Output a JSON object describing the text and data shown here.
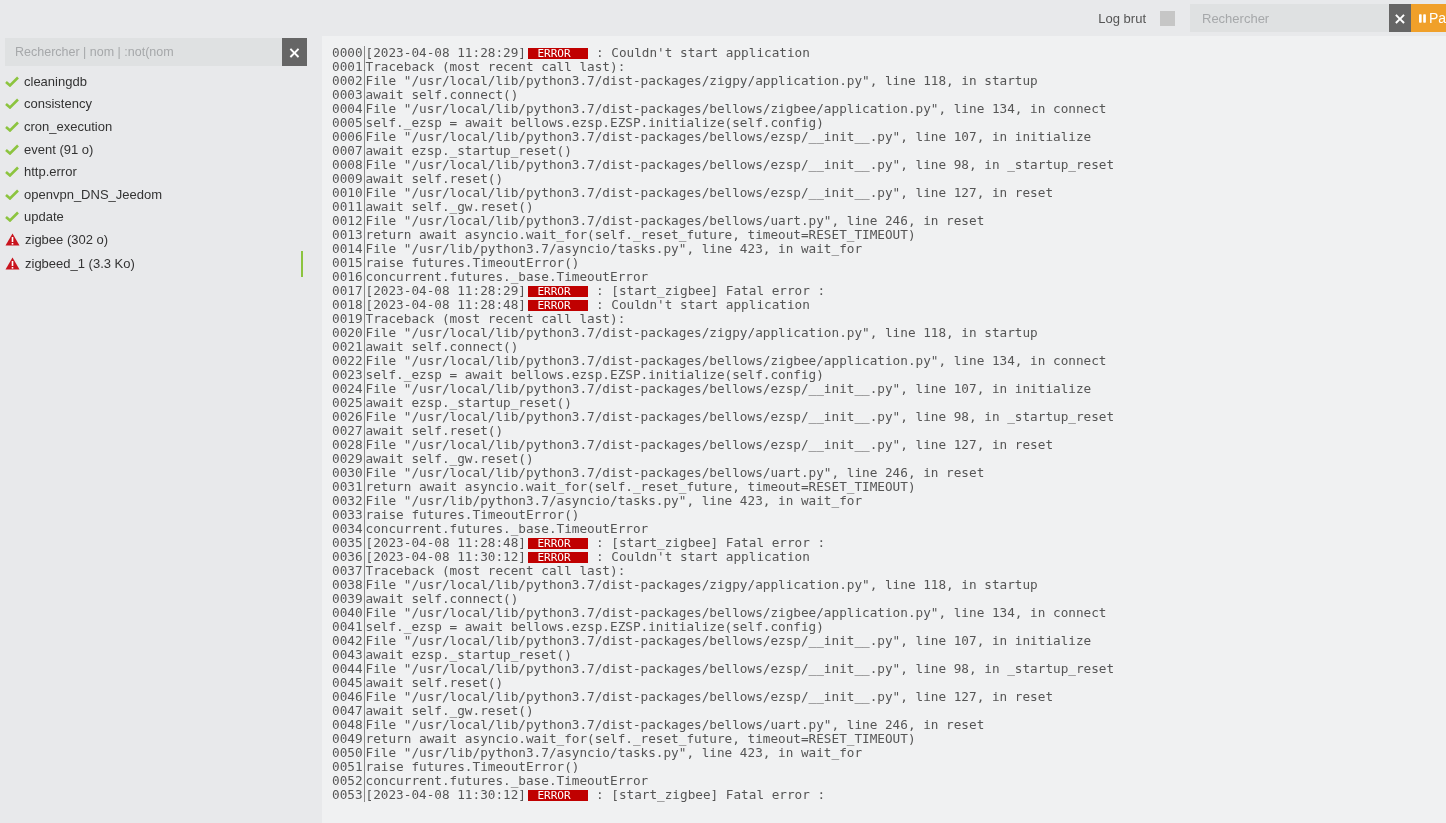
{
  "toolbar": {
    "raw_log_label": "Log brut",
    "raw_log_checked": false,
    "search": {
      "placeholder": "Rechercher"
    },
    "clear_button": "×",
    "pause_button": "Pa"
  },
  "sidebar": {
    "search": {
      "placeholder": "Rechercher | nom | :not(nom"
    },
    "clear_button": "×",
    "items": [
      {
        "label": "cleaningdb",
        "kind": "check",
        "selected": false
      },
      {
        "label": "consistency",
        "kind": "check",
        "selected": false
      },
      {
        "label": "cron_execution",
        "kind": "check",
        "selected": false
      },
      {
        "label": "event (91 o)",
        "kind": "check",
        "selected": false
      },
      {
        "label": "http.error",
        "kind": "check",
        "selected": false
      },
      {
        "label": "openvpn_DNS_Jeedom",
        "kind": "check",
        "selected": false
      },
      {
        "label": "update",
        "kind": "check",
        "selected": false
      },
      {
        "label": "zigbee (302 o)",
        "kind": "warning",
        "selected": false
      },
      {
        "label": "zigbeed_1 (3.3 Ko)",
        "kind": "warning",
        "selected": true
      }
    ]
  },
  "log": [
    {
      "number": "0000",
      "kind": "entry",
      "timestamp": "[2023-04-08 11:28:29]",
      "badge": "ERROR",
      "text": ": Couldn't start application"
    },
    {
      "number": "0001",
      "kind": "plain",
      "text": "Traceback (most recent call last):"
    },
    {
      "number": "0002",
      "kind": "plain",
      "text": "File \"/usr/local/lib/python3.7/dist-packages/zigpy/application.py\", line 118, in startup"
    },
    {
      "number": "0003",
      "kind": "plain",
      "text": "await self.connect()"
    },
    {
      "number": "0004",
      "kind": "plain",
      "text": "File \"/usr/local/lib/python3.7/dist-packages/bellows/zigbee/application.py\", line 134, in connect"
    },
    {
      "number": "0005",
      "kind": "plain",
      "text": "self._ezsp = await bellows.ezsp.EZSP.initialize(self.config)"
    },
    {
      "number": "0006",
      "kind": "plain",
      "text": "File \"/usr/local/lib/python3.7/dist-packages/bellows/ezsp/__init__.py\", line 107, in initialize"
    },
    {
      "number": "0007",
      "kind": "plain",
      "text": "await ezsp._startup_reset()"
    },
    {
      "number": "0008",
      "kind": "plain",
      "text": "File \"/usr/local/lib/python3.7/dist-packages/bellows/ezsp/__init__.py\", line 98, in _startup_reset"
    },
    {
      "number": "0009",
      "kind": "plain",
      "text": "await self.reset()"
    },
    {
      "number": "0010",
      "kind": "plain",
      "text": "File \"/usr/local/lib/python3.7/dist-packages/bellows/ezsp/__init__.py\", line 127, in reset"
    },
    {
      "number": "0011",
      "kind": "plain",
      "text": "await self._gw.reset()"
    },
    {
      "number": "0012",
      "kind": "plain",
      "text": "File \"/usr/local/lib/python3.7/dist-packages/bellows/uart.py\", line 246, in reset"
    },
    {
      "number": "0013",
      "kind": "plain",
      "text": "return await asyncio.wait_for(self._reset_future, timeout=RESET_TIMEOUT)"
    },
    {
      "number": "0014",
      "kind": "plain",
      "text": "File \"/usr/lib/python3.7/asyncio/tasks.py\", line 423, in wait_for"
    },
    {
      "number": "0015",
      "kind": "plain",
      "text": "raise futures.TimeoutError()"
    },
    {
      "number": "0016",
      "kind": "plain",
      "text": "concurrent.futures._base.TimeoutError"
    },
    {
      "number": "0017",
      "kind": "entry",
      "timestamp": "[2023-04-08 11:28:29]",
      "badge": "ERROR",
      "text": ": [start_zigbee] Fatal error :"
    },
    {
      "number": "0018",
      "kind": "entry",
      "timestamp": "[2023-04-08 11:28:48]",
      "badge": "ERROR",
      "text": ": Couldn't start application"
    },
    {
      "number": "0019",
      "kind": "plain",
      "text": "Traceback (most recent call last):"
    },
    {
      "number": "0020",
      "kind": "plain",
      "text": "File \"/usr/local/lib/python3.7/dist-packages/zigpy/application.py\", line 118, in startup"
    },
    {
      "number": "0021",
      "kind": "plain",
      "text": "await self.connect()"
    },
    {
      "number": "0022",
      "kind": "plain",
      "text": "File \"/usr/local/lib/python3.7/dist-packages/bellows/zigbee/application.py\", line 134, in connect"
    },
    {
      "number": "0023",
      "kind": "plain",
      "text": "self._ezsp = await bellows.ezsp.EZSP.initialize(self.config)"
    },
    {
      "number": "0024",
      "kind": "plain",
      "text": "File \"/usr/local/lib/python3.7/dist-packages/bellows/ezsp/__init__.py\", line 107, in initialize"
    },
    {
      "number": "0025",
      "kind": "plain",
      "text": "await ezsp._startup_reset()"
    },
    {
      "number": "0026",
      "kind": "plain",
      "text": "File \"/usr/local/lib/python3.7/dist-packages/bellows/ezsp/__init__.py\", line 98, in _startup_reset"
    },
    {
      "number": "0027",
      "kind": "plain",
      "text": "await self.reset()"
    },
    {
      "number": "0028",
      "kind": "plain",
      "text": "File \"/usr/local/lib/python3.7/dist-packages/bellows/ezsp/__init__.py\", line 127, in reset"
    },
    {
      "number": "0029",
      "kind": "plain",
      "text": "await self._gw.reset()"
    },
    {
      "number": "0030",
      "kind": "plain",
      "text": "File \"/usr/local/lib/python3.7/dist-packages/bellows/uart.py\", line 246, in reset"
    },
    {
      "number": "0031",
      "kind": "plain",
      "text": "return await asyncio.wait_for(self._reset_future, timeout=RESET_TIMEOUT)"
    },
    {
      "number": "0032",
      "kind": "plain",
      "text": "File \"/usr/lib/python3.7/asyncio/tasks.py\", line 423, in wait_for"
    },
    {
      "number": "0033",
      "kind": "plain",
      "text": "raise futures.TimeoutError()"
    },
    {
      "number": "0034",
      "kind": "plain",
      "text": "concurrent.futures._base.TimeoutError"
    },
    {
      "number": "0035",
      "kind": "entry",
      "timestamp": "[2023-04-08 11:28:48]",
      "badge": "ERROR",
      "text": ": [start_zigbee] Fatal error :"
    },
    {
      "number": "0036",
      "kind": "entry",
      "timestamp": "[2023-04-08 11:30:12]",
      "badge": "ERROR",
      "text": ": Couldn't start application"
    },
    {
      "number": "0037",
      "kind": "plain",
      "text": "Traceback (most recent call last):"
    },
    {
      "number": "0038",
      "kind": "plain",
      "text": "File \"/usr/local/lib/python3.7/dist-packages/zigpy/application.py\", line 118, in startup"
    },
    {
      "number": "0039",
      "kind": "plain",
      "text": "await self.connect()"
    },
    {
      "number": "0040",
      "kind": "plain",
      "text": "File \"/usr/local/lib/python3.7/dist-packages/bellows/zigbee/application.py\", line 134, in connect"
    },
    {
      "number": "0041",
      "kind": "plain",
      "text": "self._ezsp = await bellows.ezsp.EZSP.initialize(self.config)"
    },
    {
      "number": "0042",
      "kind": "plain",
      "text": "File \"/usr/local/lib/python3.7/dist-packages/bellows/ezsp/__init__.py\", line 107, in initialize"
    },
    {
      "number": "0043",
      "kind": "plain",
      "text": "await ezsp._startup_reset()"
    },
    {
      "number": "0044",
      "kind": "plain",
      "text": "File \"/usr/local/lib/python3.7/dist-packages/bellows/ezsp/__init__.py\", line 98, in _startup_reset"
    },
    {
      "number": "0045",
      "kind": "plain",
      "text": "await self.reset()"
    },
    {
      "number": "0046",
      "kind": "plain",
      "text": "File \"/usr/local/lib/python3.7/dist-packages/bellows/ezsp/__init__.py\", line 127, in reset"
    },
    {
      "number": "0047",
      "kind": "plain",
      "text": "await self._gw.reset()"
    },
    {
      "number": "0048",
      "kind": "plain",
      "text": "File \"/usr/local/lib/python3.7/dist-packages/bellows/uart.py\", line 246, in reset"
    },
    {
      "number": "0049",
      "kind": "plain",
      "text": "return await asyncio.wait_for(self._reset_future, timeout=RESET_TIMEOUT)"
    },
    {
      "number": "0050",
      "kind": "plain",
      "text": "File \"/usr/lib/python3.7/asyncio/tasks.py\", line 423, in wait_for"
    },
    {
      "number": "0051",
      "kind": "plain",
      "text": "raise futures.TimeoutError()"
    },
    {
      "number": "0052",
      "kind": "plain",
      "text": "concurrent.futures._base.TimeoutError"
    },
    {
      "number": "0053",
      "kind": "entry",
      "timestamp": "[2023-04-08 11:30:12]",
      "badge": "ERROR",
      "text": ": [start_zigbee] Fatal error :"
    }
  ]
}
